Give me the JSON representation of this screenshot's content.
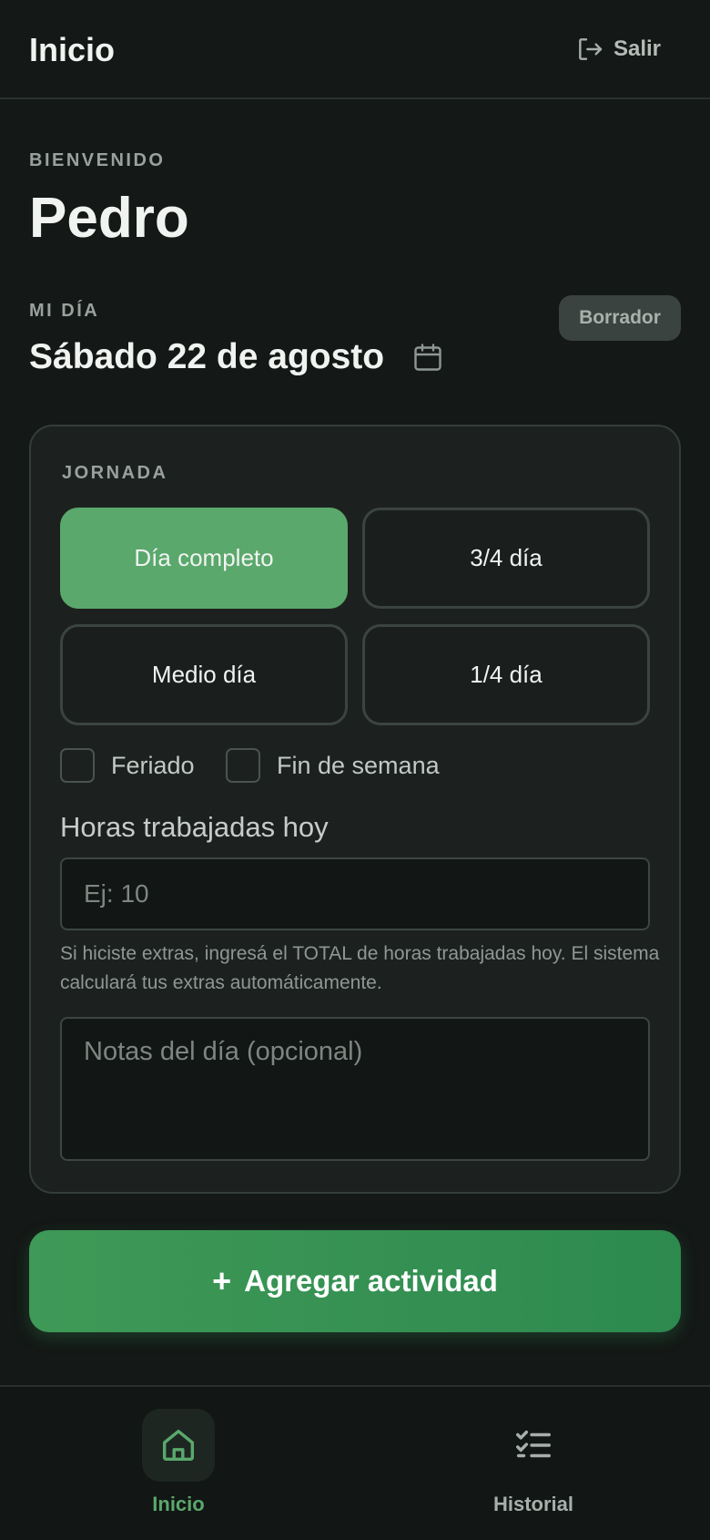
{
  "header": {
    "title": "Inicio",
    "logout_label": "Salir"
  },
  "welcome": {
    "label": "BIENVENIDO",
    "name": "Pedro"
  },
  "day": {
    "label": "MI DÍA",
    "date": "Sábado 22 de agosto",
    "status_badge": "Borrador"
  },
  "jornada": {
    "label": "JORNADA",
    "options": [
      {
        "label": "Día completo",
        "selected": true
      },
      {
        "label": "3/4 día",
        "selected": false
      },
      {
        "label": "Medio día",
        "selected": false
      },
      {
        "label": "1/4 día",
        "selected": false
      }
    ],
    "checkboxes": [
      {
        "label": "Feriado",
        "checked": false
      },
      {
        "label": "Fin de semana",
        "checked": false
      }
    ],
    "hours_label": "Horas trabajadas hoy",
    "hours_placeholder": "Ej: 10",
    "hours_value": "",
    "help_text": "Si hiciste extras, ingresá el TOTAL de horas trabajadas hoy. El sistema calculará tus extras automáticamente.",
    "notes_placeholder": "Notas del día (opcional)"
  },
  "actions": {
    "add_activity": "Agregar actividad",
    "add_icon": "+"
  },
  "bottom_nav": {
    "items": [
      {
        "label": "Inicio",
        "icon": "home-icon",
        "active": true
      },
      {
        "label": "Historial",
        "icon": "checklist-icon",
        "active": false
      }
    ]
  },
  "colors": {
    "accent": "#5aa86c",
    "button": "#3f9957",
    "background": "#141816"
  }
}
